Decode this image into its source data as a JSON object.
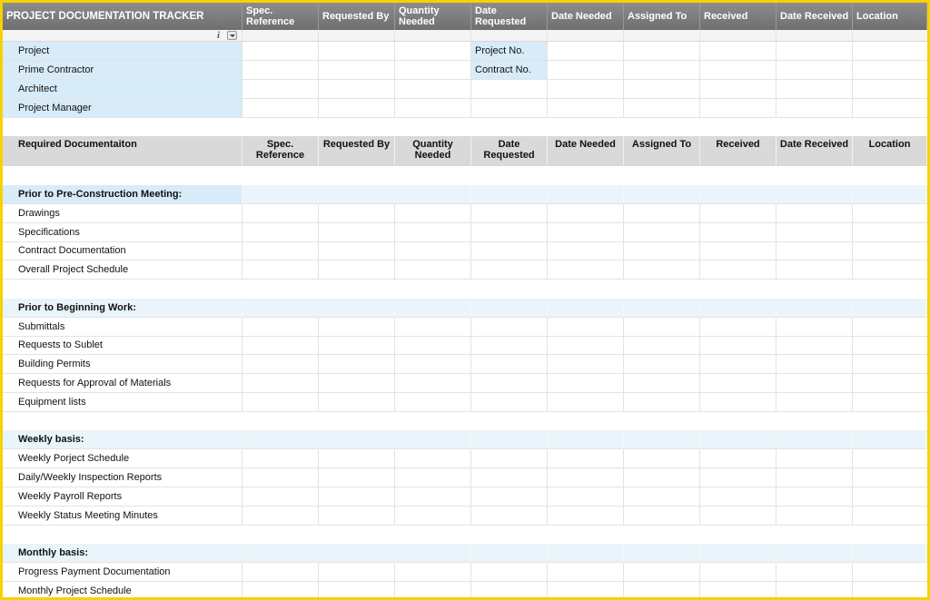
{
  "title": "PROJECT DOCUMENTATION TRACKER",
  "top_headers": [
    "Spec. Reference",
    "Requested By",
    "Quantity Needed",
    "Date Requested",
    "Date Needed",
    "Assigned To",
    "Received",
    "Date Received",
    "Location"
  ],
  "info": {
    "left": [
      "Project",
      "Prime Contractor",
      "Architect",
      "Project Manager"
    ],
    "right": [
      "Project No.",
      "Contract No."
    ]
  },
  "section_header": {
    "first": "Required Documentaiton",
    "columns": [
      "Spec. Reference",
      "Requested By",
      "Quantity Needed",
      "Date Requested",
      "Date Needed",
      "Assigned To",
      "Received",
      "Date Received",
      "Location"
    ]
  },
  "categories": [
    {
      "title": "Prior to Pre-Construction Meeting:",
      "items": [
        "Drawings",
        "Specifications",
        "Contract Documentation",
        "Overall Project Schedule"
      ]
    },
    {
      "title": "Prior to Beginning Work:",
      "items": [
        "Submittals",
        "Requests to Sublet",
        "Building Permits",
        "Requests for Approval of Materials",
        "Equipment lists"
      ]
    },
    {
      "title": "Weekly basis:",
      "items": [
        "Weekly Porject Schedule",
        "Daily/Weekly Inspection Reports",
        "Weekly Payroll Reports",
        "Weekly Status Meeting Minutes"
      ]
    },
    {
      "title": "Monthly basis:",
      "items": [
        "Progress Payment Documentation",
        "Monthly Project Schedule"
      ]
    }
  ],
  "colors": {
    "frame": "#f5d200",
    "header_dark": "#7a7a7a",
    "label_blue": "#d7ebf8",
    "category_blue": "#e9f5fb"
  },
  "icons": [
    "info-icon",
    "filter-dropdown-icon"
  ]
}
